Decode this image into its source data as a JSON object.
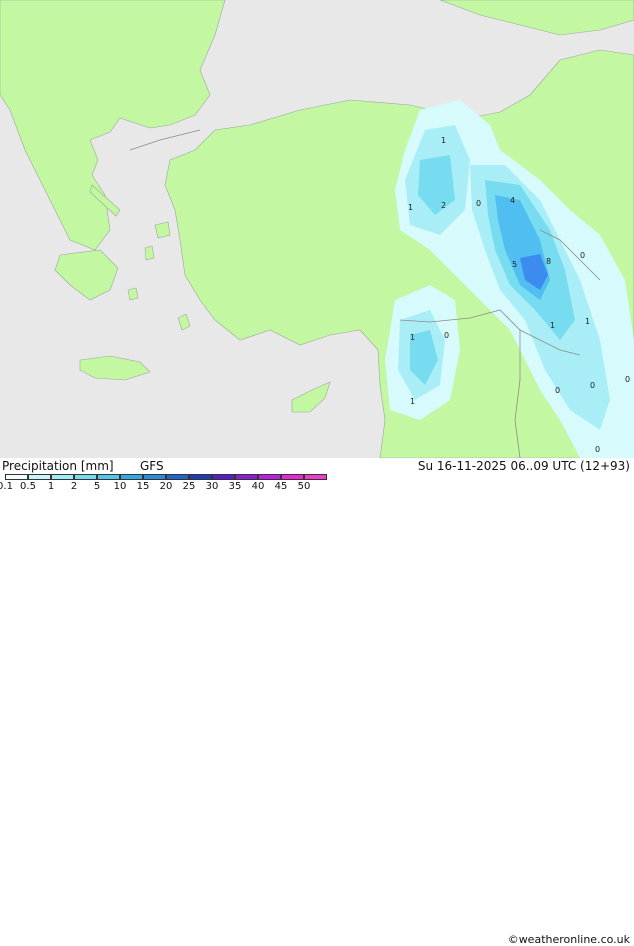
{
  "footer": {
    "product": "Precipitation [mm]",
    "model": "GFS",
    "datetime": "Su 16-11-2025 06..09 UTC (12+93)",
    "watermark": "©weatheronline.co.uk"
  },
  "legend": {
    "ticks": [
      "0.1",
      "0.5",
      "1",
      "2",
      "5",
      "10",
      "15",
      "20",
      "25",
      "30",
      "35",
      "40",
      "45",
      "50"
    ],
    "colors": [
      "#f2ffff",
      "#c8f5fa",
      "#a0ebf5",
      "#78dcf0",
      "#50c8eb",
      "#32aae1",
      "#288cd7",
      "#2364c8",
      "#1e3cb4",
      "#5a1ec8",
      "#8c1ed2",
      "#be1ee1",
      "#e628d7",
      "#f03cc8"
    ]
  },
  "map": {
    "colors": {
      "land": "#c3f7a2",
      "sea": "#e8e8e8",
      "border": "#999999"
    },
    "value_labels": [
      "1",
      "1",
      "2",
      "0",
      "4",
      "5",
      "8",
      "0",
      "1",
      "1",
      "0",
      "1",
      "0",
      "0",
      "0",
      "0",
      "1"
    ]
  }
}
